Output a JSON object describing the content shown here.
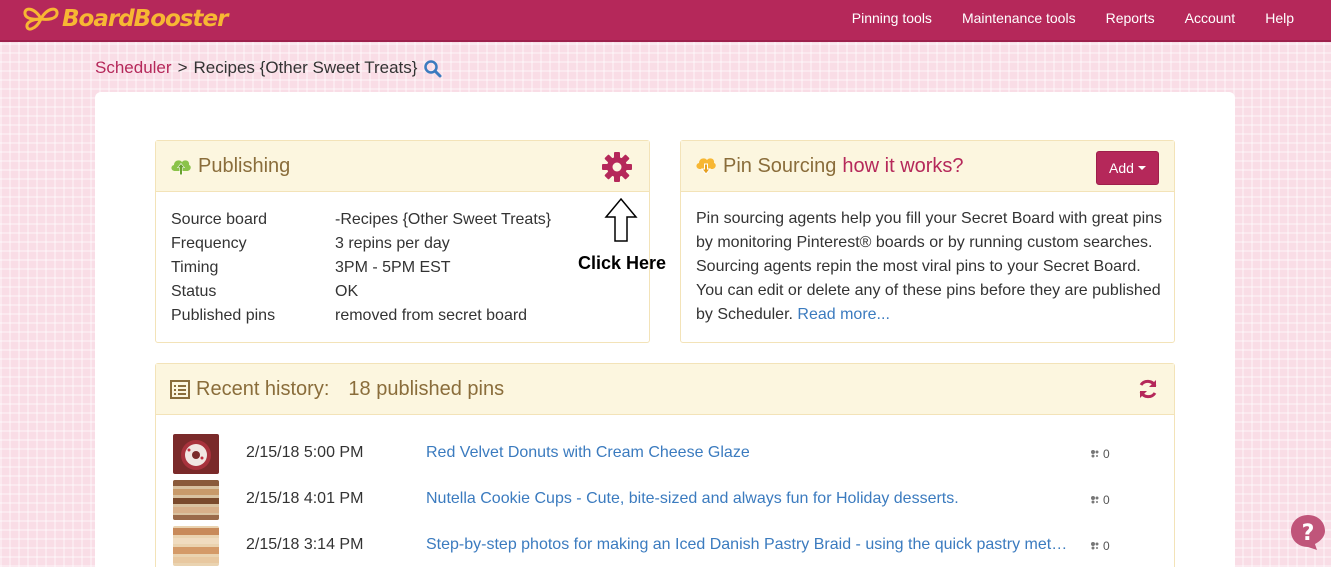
{
  "app": {
    "brand": "BoardBooster"
  },
  "nav": [
    "Pinning tools",
    "Maintenance tools",
    "Reports",
    "Account",
    "Help"
  ],
  "breadcrumb": {
    "link": "Scheduler",
    "separator": ">",
    "current": "Recipes {Other Sweet Treats}"
  },
  "publishing": {
    "title": "Publishing",
    "rows": [
      {
        "label": "Source board",
        "value": "-Recipes {Other Sweet Treats}"
      },
      {
        "label": "Frequency",
        "value": "3 repins per day"
      },
      {
        "label": "Timing",
        "value": "3PM - 5PM EST"
      },
      {
        "label": "Status",
        "value": "OK"
      },
      {
        "label": "Published pins",
        "value": "removed from secret board"
      }
    ]
  },
  "annotation": {
    "text": "Click Here"
  },
  "pin_sourcing": {
    "title": "Pin Sourcing",
    "how_link": "how it works?",
    "add_label": "Add",
    "description": "Pin sourcing agents help you fill your Secret Board with great pins by monitoring Pinterest® boards or by running custom searches. Sourcing agents repin the most viral pins to your Secret Board. You can edit or delete any of these pins before they are published by Scheduler.",
    "read_more": "Read more..."
  },
  "history": {
    "title": "Recent history:",
    "count": "18 published pins",
    "items": [
      {
        "date": "2/15/18 5:00 PM",
        "title": "Red Velvet Donuts with Cream Cheese Glaze",
        "repins": "0"
      },
      {
        "date": "2/15/18 4:01 PM",
        "title": "Nutella Cookie Cups - Cute, bite-sized and always fun for Holiday desserts.",
        "repins": "0"
      },
      {
        "date": "2/15/18 3:14 PM",
        "title": "Step-by-step photos for making an Iced Danish Pastry Braid - using the quick pastry method...",
        "repins": "0"
      }
    ]
  },
  "colors": {
    "brand": "#b5285a",
    "link": "#3b7bbf",
    "panel_heading": "#fcf6df",
    "panel_text": "#8a6d3b",
    "logo": "#f7b733"
  }
}
